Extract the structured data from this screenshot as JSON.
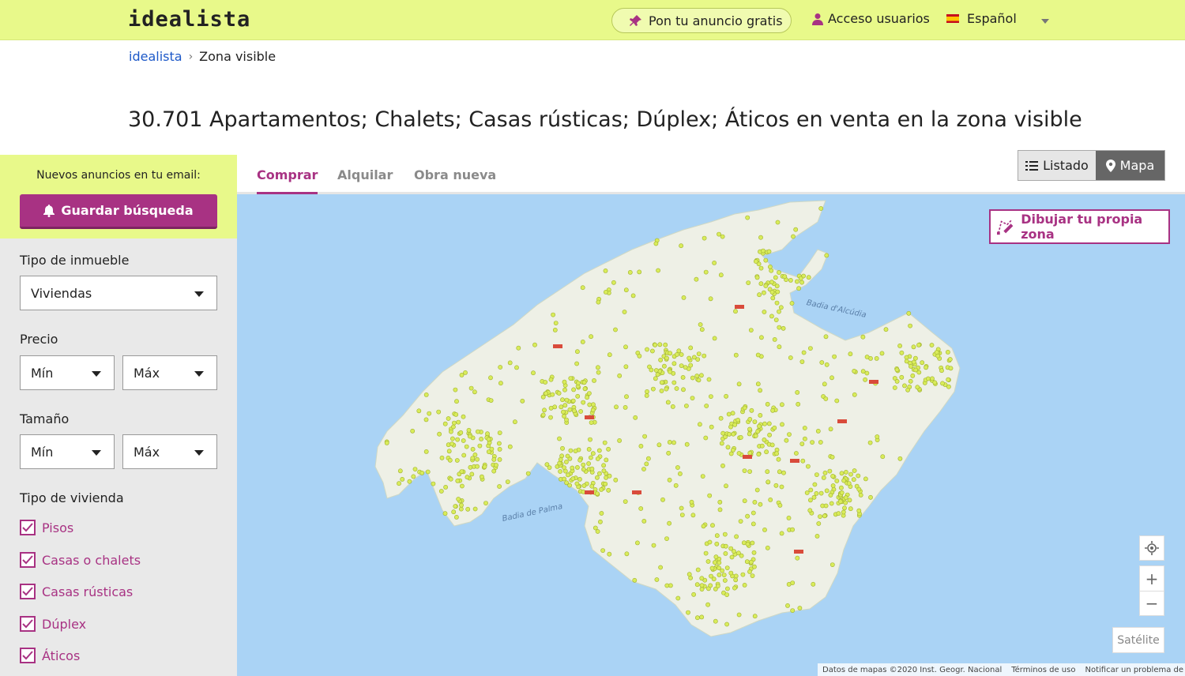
{
  "header": {
    "logo": "idealista",
    "post_ad": "Pon tu anuncio gratis",
    "login": "Acceso usuarios",
    "language": "Español"
  },
  "breadcrumb": {
    "home": "idealista",
    "current": "Zona visible"
  },
  "page_title": "30.701 Apartamentos; Chalets; Casas rústicas; Dúplex; Áticos en venta en la zona visible",
  "sidebar": {
    "alerts_caption": "Nuevos anuncios en tu email:",
    "save_search": "Guardar búsqueda",
    "property_type_label": "Tipo de inmueble",
    "property_type_value": "Viviendas",
    "price_label": "Precio",
    "price_min": "Mín",
    "price_max": "Máx",
    "size_label": "Tamaño",
    "size_min": "Mín",
    "size_max": "Máx",
    "housing_type_label": "Tipo de vivienda",
    "housing_types": [
      "Pisos",
      "Casas o chalets",
      "Casas rústicas",
      "Dúplex",
      "Áticos"
    ]
  },
  "tabs": [
    "Comprar",
    "Alquilar",
    "Obra nueva"
  ],
  "view_toggle": {
    "list": "Listado",
    "map": "Mapa"
  },
  "map": {
    "draw_zone": "Dibujar tu propia zona",
    "zoom_in": "+",
    "zoom_out": "−",
    "satellite": "Satélite",
    "attribution": "Datos de mapas ©2020 Inst. Geogr. Nacional",
    "terms": "Términos de uso",
    "report": "Notificar un problema de Maps",
    "labels": {
      "bay_alcudia": "Badia d'Alcúdia",
      "bay_palma": "Badia de Palma"
    }
  },
  "colors": {
    "accent": "#a83283",
    "header_bg": "#e8f98a",
    "sea": "#aad3f5",
    "land": "#eef0e6",
    "marker": "#d9ec5a"
  }
}
